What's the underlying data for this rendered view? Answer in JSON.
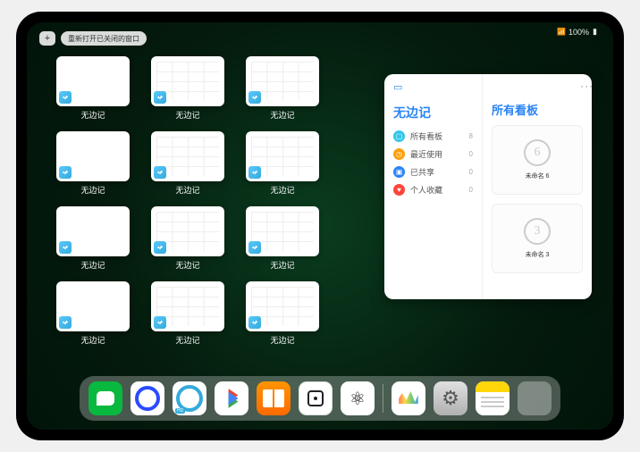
{
  "status_bar": {
    "battery_percent": "100%"
  },
  "top_left": {
    "plus": "+",
    "reopen_label": "重新打开已关闭的窗口"
  },
  "app_name": "无边记",
  "windows": [
    {
      "label": "无边记",
      "has_content": false
    },
    {
      "label": "无边记",
      "has_content": true
    },
    {
      "label": "无边记",
      "has_content": true
    },
    {
      "label": "无边记",
      "has_content": false
    },
    {
      "label": "无边记",
      "has_content": true
    },
    {
      "label": "无边记",
      "has_content": true
    },
    {
      "label": "无边记",
      "has_content": false
    },
    {
      "label": "无边记",
      "has_content": true
    },
    {
      "label": "无边记",
      "has_content": true
    },
    {
      "label": "无边记",
      "has_content": false
    },
    {
      "label": "无边记",
      "has_content": true
    },
    {
      "label": "无边记",
      "has_content": true
    }
  ],
  "panel": {
    "left_title": "无边记",
    "right_title": "所有看板",
    "menu": [
      {
        "label": "所有看板",
        "count": "8"
      },
      {
        "label": "最近使用",
        "count": "0"
      },
      {
        "label": "已共享",
        "count": "0"
      },
      {
        "label": "个人收藏",
        "count": "0"
      }
    ],
    "boards": [
      {
        "digit": "6",
        "name": "未命名 6",
        "sub": ""
      },
      {
        "digit": "3",
        "name": "未命名 3",
        "sub": ""
      }
    ]
  },
  "dock": {
    "items": [
      {
        "name": "wechat"
      },
      {
        "name": "quark"
      },
      {
        "name": "quark-hd"
      },
      {
        "name": "play"
      },
      {
        "name": "books"
      },
      {
        "name": "dice"
      },
      {
        "name": "molecule"
      },
      {
        "name": "freeform"
      },
      {
        "name": "settings"
      },
      {
        "name": "notes"
      },
      {
        "name": "appfolder"
      }
    ]
  }
}
